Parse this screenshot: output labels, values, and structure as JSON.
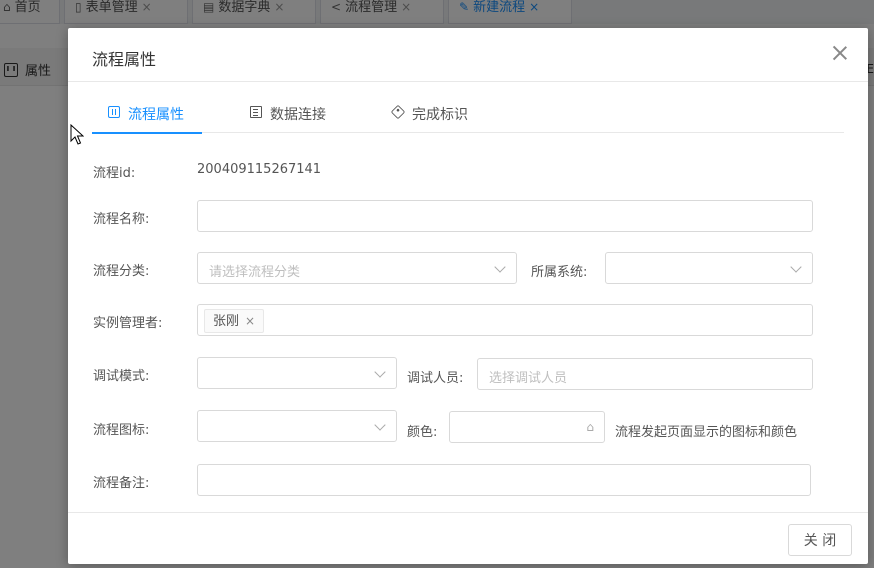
{
  "background": {
    "tabs": [
      {
        "label": "首页",
        "icon": "home-icon"
      },
      {
        "label": "表单管理",
        "icon": "file-icon"
      },
      {
        "label": "数据字典",
        "icon": "dictionary-icon"
      },
      {
        "label": "流程管理",
        "icon": "share-icon"
      },
      {
        "label": "新建流程",
        "icon": "edit-icon"
      }
    ],
    "toolbar": {
      "properties_label": "属性",
      "right_text": "E"
    }
  },
  "dialog": {
    "title": "流程属性",
    "tabs": [
      {
        "label": "流程属性",
        "icon": "sliders-icon"
      },
      {
        "label": "数据连接",
        "icon": "book-icon"
      },
      {
        "label": "完成标识",
        "icon": "tag-icon"
      }
    ],
    "form": {
      "flow_id_label": "流程id:",
      "flow_id_value": "200409115267141",
      "name_label": "流程名称:",
      "name_value": "",
      "category_label": "流程分类:",
      "category_placeholder": "请选择流程分类",
      "system_label": "所属系统:",
      "system_value": "",
      "manager_label": "实例管理者:",
      "managers": [
        "张刚"
      ],
      "debug_mode_label": "调试模式:",
      "debug_mode_value": "",
      "debugger_label": "调试人员:",
      "debugger_placeholder": "选择调试人员",
      "icon_label": "流程图标:",
      "icon_value": "",
      "color_label": "颜色:",
      "color_value": "",
      "icon_hint": "流程发起页面显示的图标和颜色",
      "remark_label": "流程备注:",
      "remark_value": ""
    },
    "footer": {
      "close_button": "关 闭"
    }
  },
  "colors": {
    "accent": "#1890ff",
    "overlay": "rgba(0,0,0,0.5)"
  }
}
